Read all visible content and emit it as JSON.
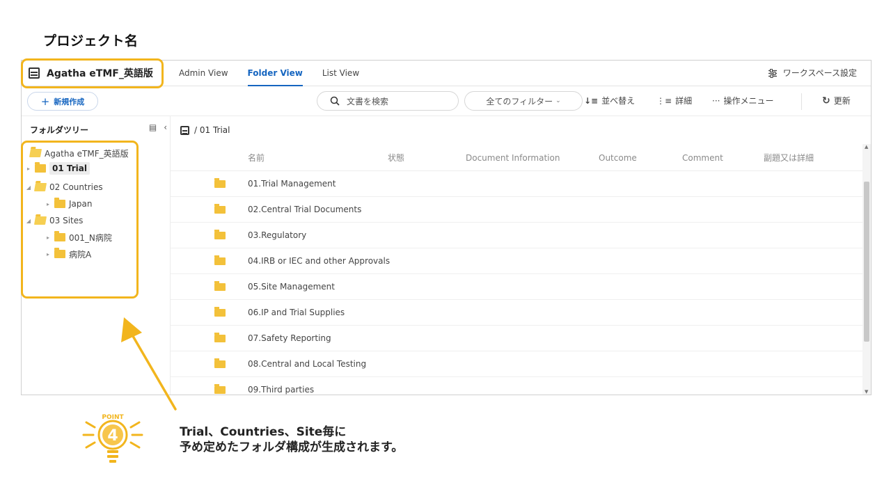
{
  "page": {
    "title": "プロジェクト名"
  },
  "workspace": {
    "name": "Agatha eTMF_英語版",
    "settings_label": "ワークスペース設定"
  },
  "tabs": [
    {
      "label": "Admin View",
      "active": false
    },
    {
      "label": "Folder View",
      "active": true
    },
    {
      "label": "List View",
      "active": false
    }
  ],
  "toolbar": {
    "new_label": "新規作成",
    "search_placeholder": "文書を検索",
    "filter_label": "全てのフィルター",
    "sort_label": "並べ替え",
    "detail_label": "詳細",
    "menu_label": "操作メニュー",
    "refresh_label": "更新"
  },
  "sidebar": {
    "title": "フォルダツリー",
    "tree": [
      {
        "label": "Agatha eTMF_英語版",
        "depth": 0,
        "expanded": true,
        "has_caret": false
      },
      {
        "label": "01 Trial",
        "depth": 0,
        "expanded": false,
        "selected": true
      },
      {
        "label": "02 Countries",
        "depth": 0,
        "expanded": true
      },
      {
        "label": "Japan",
        "depth": 1,
        "expanded": false
      },
      {
        "label": "03 Sites",
        "depth": 0,
        "expanded": true
      },
      {
        "label": "001_N病院",
        "depth": 1,
        "expanded": false
      },
      {
        "label": "病院A",
        "depth": 1,
        "expanded": false
      }
    ]
  },
  "breadcrumb": {
    "path": "/ 01 Trial"
  },
  "table": {
    "columns": [
      "名前",
      "状態",
      "Document Information",
      "Outcome",
      "Comment",
      "副題又は詳細"
    ],
    "rows": [
      "01.Trial Management",
      "02.Central Trial Documents",
      "03.Regulatory",
      "04.IRB or IEC and other Approvals",
      "05.Site Management",
      "06.IP and Trial Supplies",
      "07.Safety Reporting",
      "08.Central and Local Testing",
      "09.Third parties"
    ]
  },
  "annotation": {
    "badge_text": "POINT",
    "badge_number": "4",
    "line1": "Trial、Countries、Site毎に",
    "line2": "予め定めたフォルダ構成が生成されます。",
    "highlight_color": "#f2b51d"
  }
}
